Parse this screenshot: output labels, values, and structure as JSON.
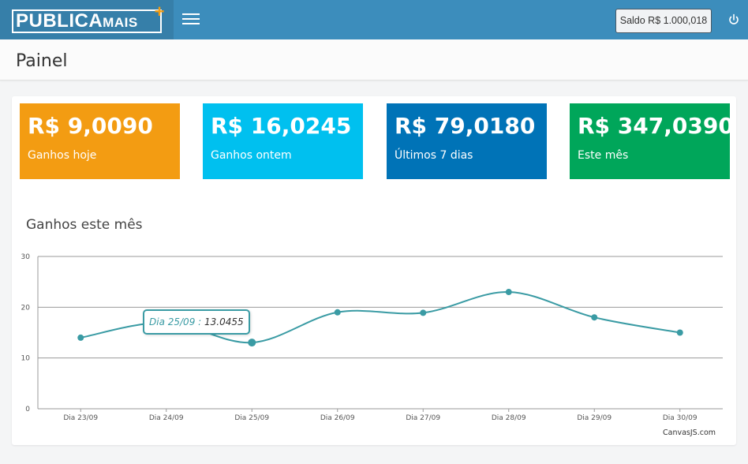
{
  "header": {
    "logo_text": "PUBLICA",
    "logo_mais": "MAIS",
    "logo_plus": "+",
    "saldo_label": "Saldo R$ 1.000,018"
  },
  "page": {
    "title": "Painel"
  },
  "stats": [
    {
      "value": "R$ 9,0090",
      "label": "Ganhos hoje",
      "color": "#f39c12"
    },
    {
      "value": "R$ 16,0245",
      "label": "Ganhos ontem",
      "color": "#00c0ef"
    },
    {
      "value": "R$ 79,0180",
      "label": "Últimos 7 dias",
      "color": "#0073b7"
    },
    {
      "value": "R$ 347,0390",
      "label": "Este mês",
      "color": "#00a65a"
    }
  ],
  "chart": {
    "title": "Ganhos este mês",
    "credit": "CanvasJS.com",
    "tooltip_x": "Dia 25/09 :",
    "tooltip_y": "13.0455"
  },
  "chart_data": {
    "type": "line",
    "title": "Ganhos este mês",
    "categories": [
      "Dia 23/09",
      "Dia 24/09",
      "Dia 25/09",
      "Dia 26/09",
      "Dia 27/09",
      "Dia 28/09",
      "Dia 29/09",
      "Dia 30/09"
    ],
    "values": [
      14,
      17,
      13.0455,
      19,
      18.9,
      23,
      18,
      15
    ],
    "markers_shown": [
      true,
      false,
      true,
      true,
      true,
      true,
      true,
      true
    ],
    "ylim": [
      0,
      30
    ],
    "yticks": [
      0,
      10,
      20,
      30
    ],
    "grid": true,
    "line_color": "#3a9ba4"
  }
}
